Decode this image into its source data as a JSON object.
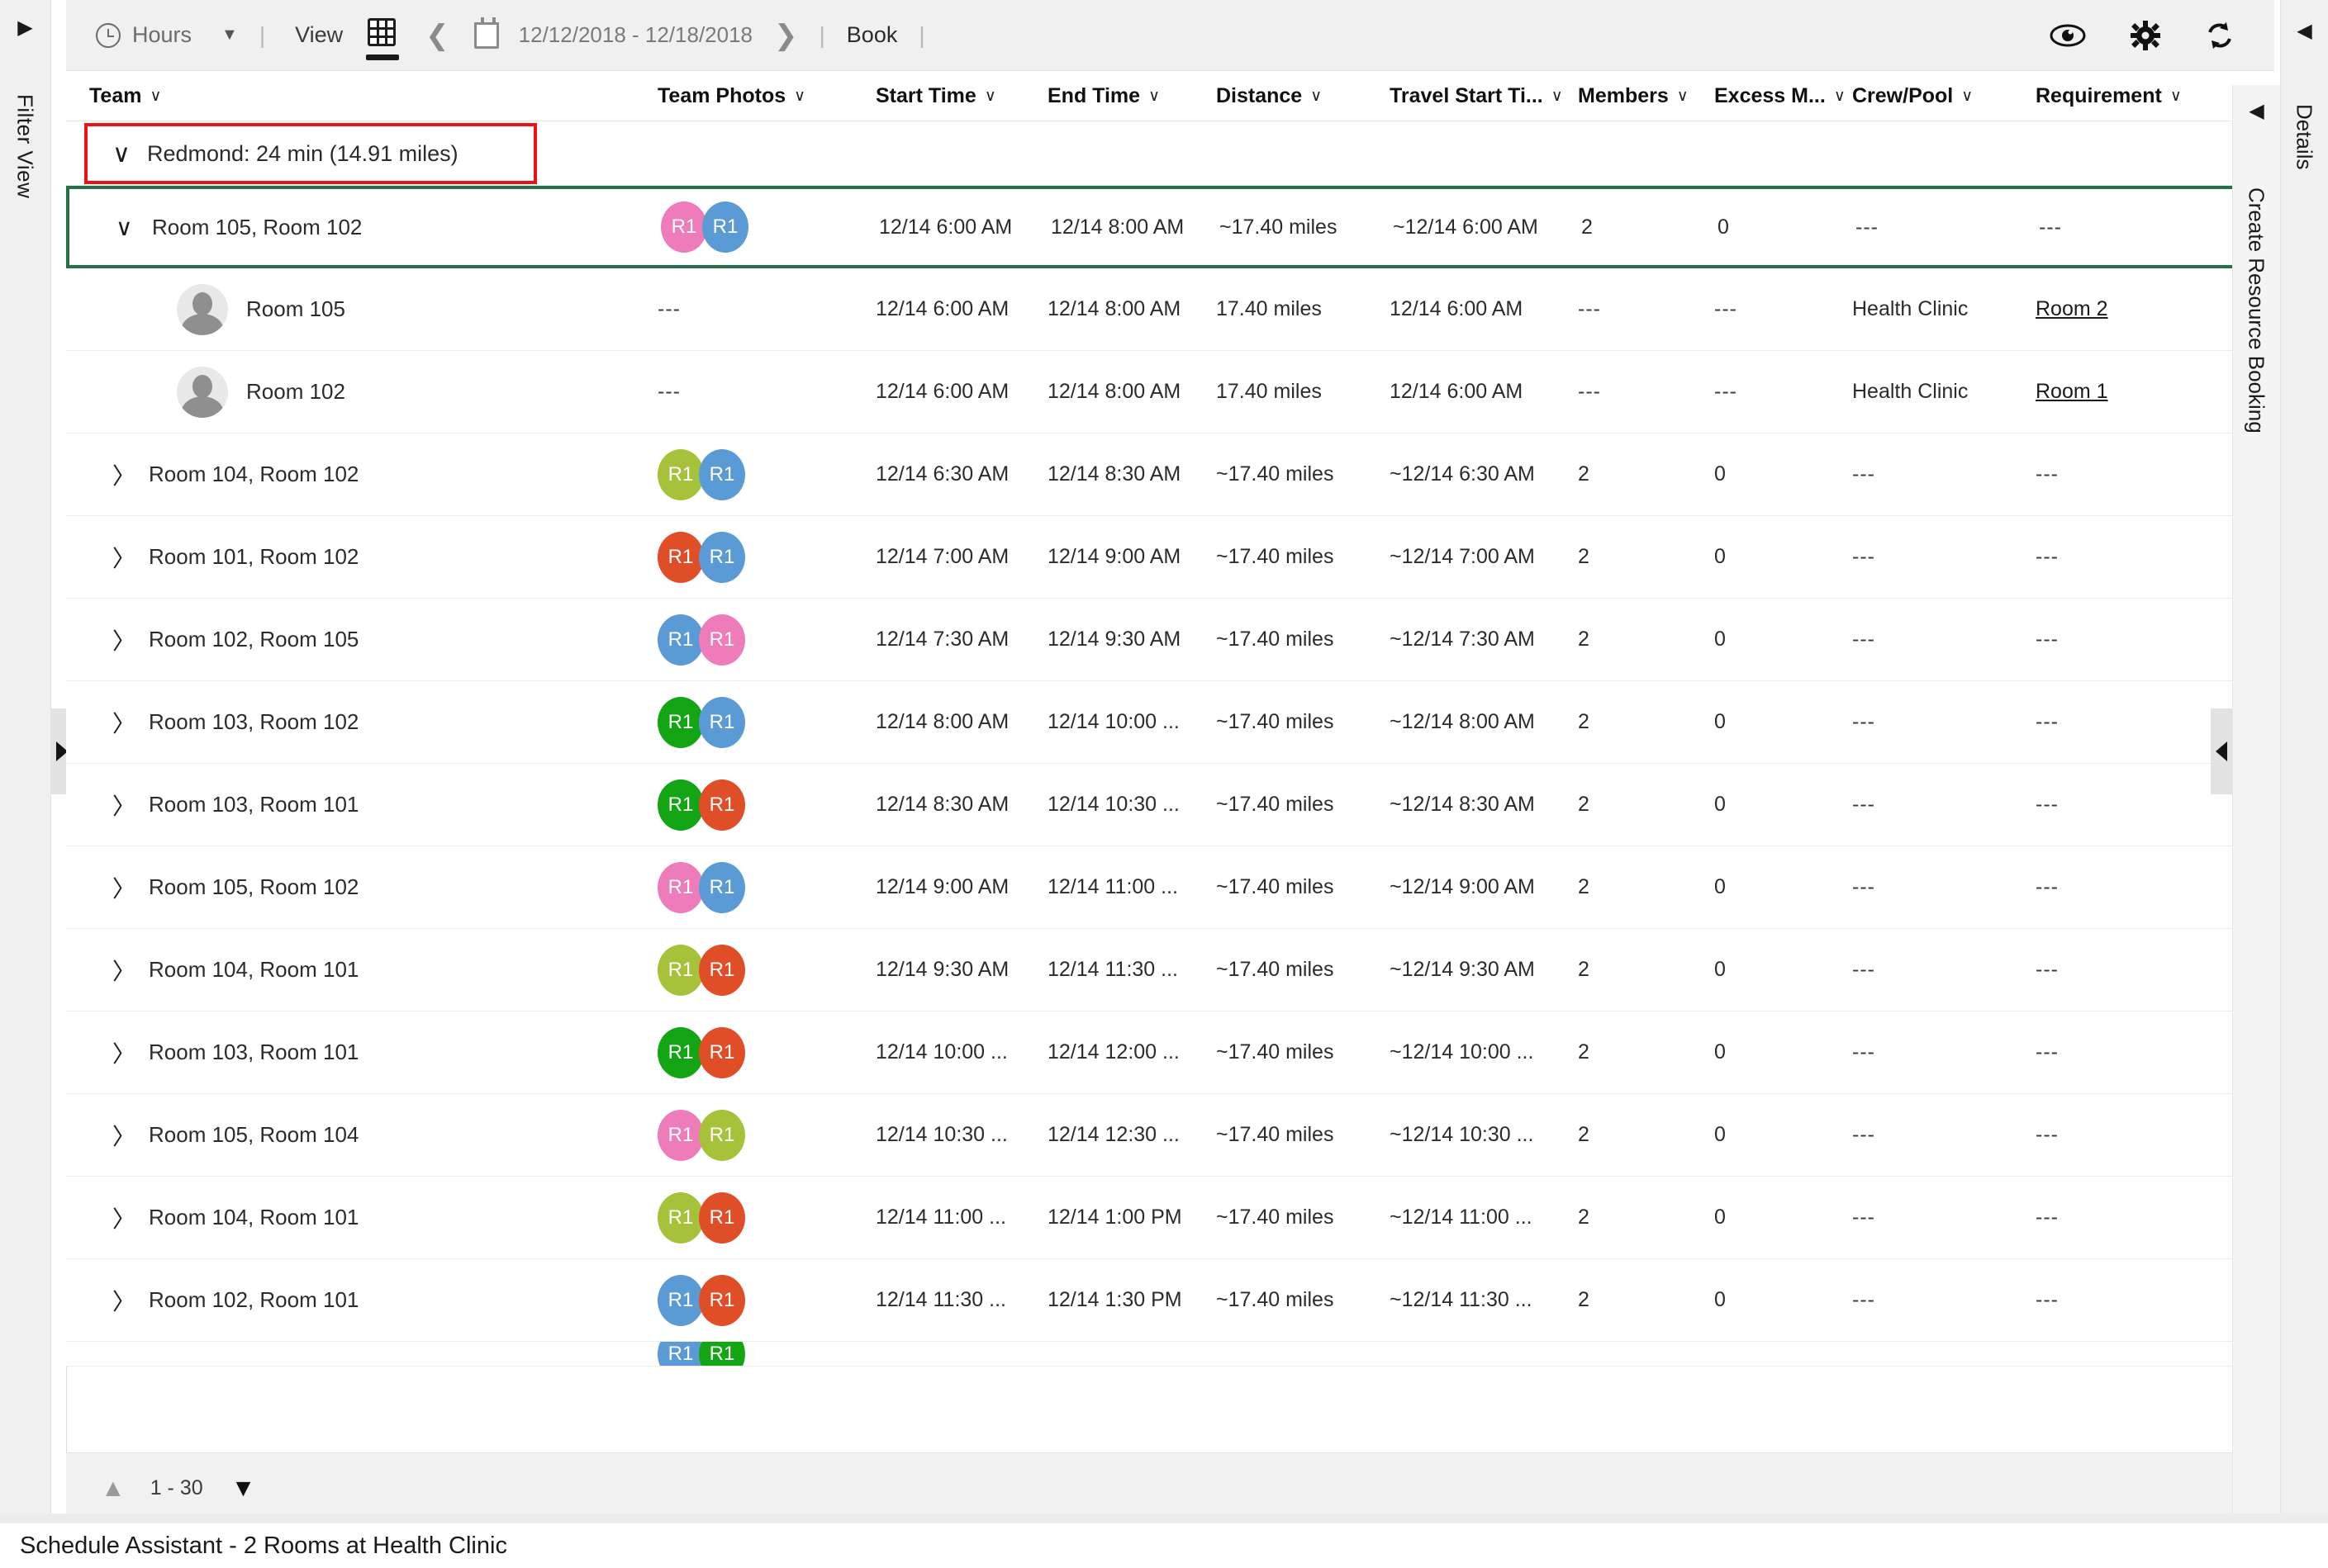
{
  "left_rail": {
    "label": "Filter View",
    "arrow_icon": "triangle-right-icon"
  },
  "right_rail": {
    "label": "Details",
    "arrow_icon": "triangle-left-icon"
  },
  "create_booking_rail": {
    "label": "Create Resource Booking",
    "arrow_icon": "triangle-left-icon"
  },
  "toolbar": {
    "hours_label": "Hours",
    "hours_icon": "clock-icon",
    "hours_caret": "▼",
    "sep": "|",
    "view_label": "View",
    "grid_view_icon": "grid-icon",
    "prev_icon": "chevron-left-icon",
    "calendar_icon": "calendar-icon",
    "date_range": "12/12/2018 - 12/18/2018",
    "next_icon": "chevron-right-icon",
    "book_label": "Book",
    "eye_icon": "eye-icon",
    "gear_icon": "gear-icon",
    "refresh_icon": "refresh-icon"
  },
  "grid": {
    "columns": [
      {
        "label": "Team",
        "sort_icon": "∨"
      },
      {
        "label": "Team Photos",
        "sort_icon": "∨"
      },
      {
        "label": "Start Time",
        "sort_icon": "∨"
      },
      {
        "label": "End Time",
        "sort_icon": "∨"
      },
      {
        "label": "Distance",
        "sort_icon": "∨"
      },
      {
        "label": "Travel Start Ti...",
        "sort_icon": "∨"
      },
      {
        "label": "Members",
        "sort_icon": "∨"
      },
      {
        "label": "Excess M...",
        "sort_icon": "∨"
      },
      {
        "label": "Crew/Pool",
        "sort_icon": "∨"
      },
      {
        "label": "Requirement",
        "sort_icon": "∨"
      }
    ],
    "group_row": {
      "expand_icon": "chevron-down-icon",
      "label": "Redmond: 24 min (14.91 miles)",
      "highlight_color": "#ee1111"
    },
    "selected_row_color": "#217346",
    "avatar_colors": {
      "Room 101": "#e04e27",
      "Room 102": "#5b9bd5",
      "Room 103": "#13a513",
      "Room 104": "#a6c23b",
      "Room 105": "#ee7bba"
    },
    "rows": [
      {
        "state": "expanded",
        "selected": true,
        "twisty": "chevron-down-icon",
        "team": "Room 105, Room 102",
        "avatars": [
          {
            "label": "R1",
            "color": "#ee7bba"
          },
          {
            "label": "R1",
            "color": "#5b9bd5"
          }
        ],
        "start_time": "12/14 6:00 AM",
        "end_time": "12/14 8:00 AM",
        "distance": "~17.40 miles",
        "travel_start": "~12/14 6:00 AM",
        "members": "2",
        "excess_members": "0",
        "crew_pool": "---",
        "requirement": "---"
      },
      {
        "state": "child",
        "person_icon": "person-avatar-icon",
        "team": "Room 105",
        "photos": "---",
        "start_time": "12/14 6:00 AM",
        "end_time": "12/14 8:00 AM",
        "distance": "17.40 miles",
        "travel_start": "12/14 6:00 AM",
        "members": "---",
        "excess_members": "---",
        "crew_pool": "Health Clinic",
        "requirement": "Room 2",
        "requirement_is_link": true
      },
      {
        "state": "child",
        "person_icon": "person-avatar-icon",
        "team": "Room 102",
        "photos": "---",
        "start_time": "12/14 6:00 AM",
        "end_time": "12/14 8:00 AM",
        "distance": "17.40 miles",
        "travel_start": "12/14 6:00 AM",
        "members": "---",
        "excess_members": "---",
        "crew_pool": "Health Clinic",
        "requirement": "Room 1",
        "requirement_is_link": true
      },
      {
        "state": "collapsed",
        "twisty": "chevron-right-icon",
        "team": "Room 104, Room 102",
        "avatars": [
          {
            "label": "R1",
            "color": "#a6c23b"
          },
          {
            "label": "R1",
            "color": "#5b9bd5"
          }
        ],
        "start_time": "12/14 6:30 AM",
        "end_time": "12/14 8:30 AM",
        "distance": "~17.40 miles",
        "travel_start": "~12/14 6:30 AM",
        "members": "2",
        "excess_members": "0",
        "crew_pool": "---",
        "requirement": "---"
      },
      {
        "state": "collapsed",
        "twisty": "chevron-right-icon",
        "team": "Room 101, Room 102",
        "avatars": [
          {
            "label": "R1",
            "color": "#e04e27"
          },
          {
            "label": "R1",
            "color": "#5b9bd5"
          }
        ],
        "start_time": "12/14 7:00 AM",
        "end_time": "12/14 9:00 AM",
        "distance": "~17.40 miles",
        "travel_start": "~12/14 7:00 AM",
        "members": "2",
        "excess_members": "0",
        "crew_pool": "---",
        "requirement": "---"
      },
      {
        "state": "collapsed",
        "twisty": "chevron-right-icon",
        "team": "Room 102, Room 105",
        "avatars": [
          {
            "label": "R1",
            "color": "#5b9bd5"
          },
          {
            "label": "R1",
            "color": "#ee7bba"
          }
        ],
        "start_time": "12/14 7:30 AM",
        "end_time": "12/14 9:30 AM",
        "distance": "~17.40 miles",
        "travel_start": "~12/14 7:30 AM",
        "members": "2",
        "excess_members": "0",
        "crew_pool": "---",
        "requirement": "---"
      },
      {
        "state": "collapsed",
        "twisty": "chevron-right-icon",
        "team": "Room 103, Room 102",
        "avatars": [
          {
            "label": "R1",
            "color": "#13a513"
          },
          {
            "label": "R1",
            "color": "#5b9bd5"
          }
        ],
        "start_time": "12/14 8:00 AM",
        "end_time": "12/14 10:00 ...",
        "distance": "~17.40 miles",
        "travel_start": "~12/14 8:00 AM",
        "members": "2",
        "excess_members": "0",
        "crew_pool": "---",
        "requirement": "---"
      },
      {
        "state": "collapsed",
        "twisty": "chevron-right-icon",
        "team": "Room 103, Room 101",
        "avatars": [
          {
            "label": "R1",
            "color": "#13a513"
          },
          {
            "label": "R1",
            "color": "#e04e27"
          }
        ],
        "start_time": "12/14 8:30 AM",
        "end_time": "12/14 10:30 ...",
        "distance": "~17.40 miles",
        "travel_start": "~12/14 8:30 AM",
        "members": "2",
        "excess_members": "0",
        "crew_pool": "---",
        "requirement": "---"
      },
      {
        "state": "collapsed",
        "twisty": "chevron-right-icon",
        "team": "Room 105, Room 102",
        "avatars": [
          {
            "label": "R1",
            "color": "#ee7bba"
          },
          {
            "label": "R1",
            "color": "#5b9bd5"
          }
        ],
        "start_time": "12/14 9:00 AM",
        "end_time": "12/14 11:00 ...",
        "distance": "~17.40 miles",
        "travel_start": "~12/14 9:00 AM",
        "members": "2",
        "excess_members": "0",
        "crew_pool": "---",
        "requirement": "---"
      },
      {
        "state": "collapsed",
        "twisty": "chevron-right-icon",
        "team": "Room 104, Room 101",
        "avatars": [
          {
            "label": "R1",
            "color": "#a6c23b"
          },
          {
            "label": "R1",
            "color": "#e04e27"
          }
        ],
        "start_time": "12/14 9:30 AM",
        "end_time": "12/14 11:30 ...",
        "distance": "~17.40 miles",
        "travel_start": "~12/14 9:30 AM",
        "members": "2",
        "excess_members": "0",
        "crew_pool": "---",
        "requirement": "---"
      },
      {
        "state": "collapsed",
        "twisty": "chevron-right-icon",
        "team": "Room 103, Room 101",
        "avatars": [
          {
            "label": "R1",
            "color": "#13a513"
          },
          {
            "label": "R1",
            "color": "#e04e27"
          }
        ],
        "start_time": "12/14 10:00 ...",
        "end_time": "12/14 12:00 ...",
        "distance": "~17.40 miles",
        "travel_start": "~12/14 10:00 ...",
        "members": "2",
        "excess_members": "0",
        "crew_pool": "---",
        "requirement": "---"
      },
      {
        "state": "collapsed",
        "twisty": "chevron-right-icon",
        "team": "Room 105, Room 104",
        "avatars": [
          {
            "label": "R1",
            "color": "#ee7bba"
          },
          {
            "label": "R1",
            "color": "#a6c23b"
          }
        ],
        "start_time": "12/14 10:30 ...",
        "end_time": "12/14 12:30 ...",
        "distance": "~17.40 miles",
        "travel_start": "~12/14 10:30 ...",
        "members": "2",
        "excess_members": "0",
        "crew_pool": "---",
        "requirement": "---"
      },
      {
        "state": "collapsed",
        "twisty": "chevron-right-icon",
        "team": "Room 104, Room 101",
        "avatars": [
          {
            "label": "R1",
            "color": "#a6c23b"
          },
          {
            "label": "R1",
            "color": "#e04e27"
          }
        ],
        "start_time": "12/14 11:00 ...",
        "end_time": "12/14 1:00 PM",
        "distance": "~17.40 miles",
        "travel_start": "~12/14 11:00 ...",
        "members": "2",
        "excess_members": "0",
        "crew_pool": "---",
        "requirement": "---"
      },
      {
        "state": "collapsed",
        "twisty": "chevron-right-icon",
        "team": "Room 102, Room 101",
        "avatars": [
          {
            "label": "R1",
            "color": "#5b9bd5"
          },
          {
            "label": "R1",
            "color": "#e04e27"
          }
        ],
        "start_time": "12/14 11:30 ...",
        "end_time": "12/14 1:30 PM",
        "distance": "~17.40 miles",
        "travel_start": "~12/14 11:30 ...",
        "members": "2",
        "excess_members": "0",
        "crew_pool": "---",
        "requirement": "---"
      },
      {
        "state": "partial",
        "avatars": [
          {
            "label": "R1",
            "color": "#5b9bd5"
          },
          {
            "label": "R1",
            "color": "#13a513"
          }
        ]
      }
    ],
    "pager": {
      "up_icon": "chevron-up-icon",
      "range": "1 - 30",
      "down_icon": "chevron-down-icon"
    },
    "scrollbar": {
      "up_icon": "caret-up-icon",
      "down_icon": "caret-down-icon"
    }
  },
  "status_bar": {
    "text": "Schedule Assistant - 2 Rooms at Health Clinic"
  }
}
